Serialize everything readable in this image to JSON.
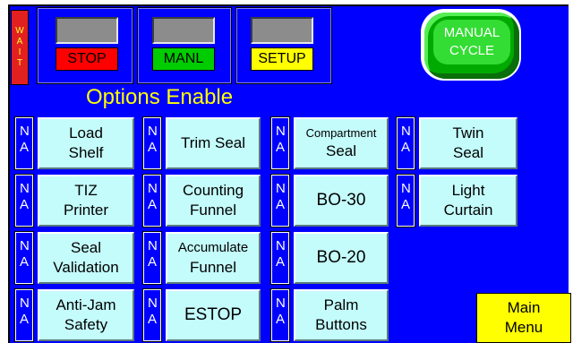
{
  "wait_label": "W\nA\nI\nT",
  "modes": {
    "stop": {
      "label": "STOP",
      "color": "#ff0000"
    },
    "manl": {
      "label": "MANL",
      "color": "#00cc00"
    },
    "setup": {
      "label": "SETUP",
      "color": "#ffff00"
    }
  },
  "manual_cycle": {
    "line1": "MANUAL",
    "line2": "CYCLE"
  },
  "title": "Options Enable",
  "na": {
    "line1": "N",
    "line2": "A"
  },
  "options": {
    "load_shelf": {
      "line1": "Load",
      "line2": "Shelf"
    },
    "trim_seal": {
      "line1": "Trim Seal"
    },
    "compartment_seal": {
      "line1": "Compartment",
      "line2": "Seal"
    },
    "twin_seal": {
      "line1": "Twin",
      "line2": "Seal"
    },
    "tiz_printer": {
      "line1": "TIZ",
      "line2": "Printer"
    },
    "counting_funnel": {
      "line1": "Counting",
      "line2": "Funnel"
    },
    "bo30": {
      "line1": "BO-30"
    },
    "light_curtain": {
      "line1": "Light",
      "line2": "Curtain"
    },
    "seal_validation": {
      "line1": "Seal",
      "line2": "Validation"
    },
    "accumulate_funnel": {
      "line1": "Accumulate",
      "line2": "Funnel"
    },
    "bo20": {
      "line1": "BO-20"
    },
    "anti_jam_safety": {
      "line1": "Anti-Jam",
      "line2": "Safety"
    },
    "estop": {
      "line1": "ESTOP"
    },
    "palm_buttons": {
      "line1": "Palm",
      "line2": "Buttons"
    }
  },
  "main_menu": {
    "line1": "Main",
    "line2": "Menu"
  }
}
